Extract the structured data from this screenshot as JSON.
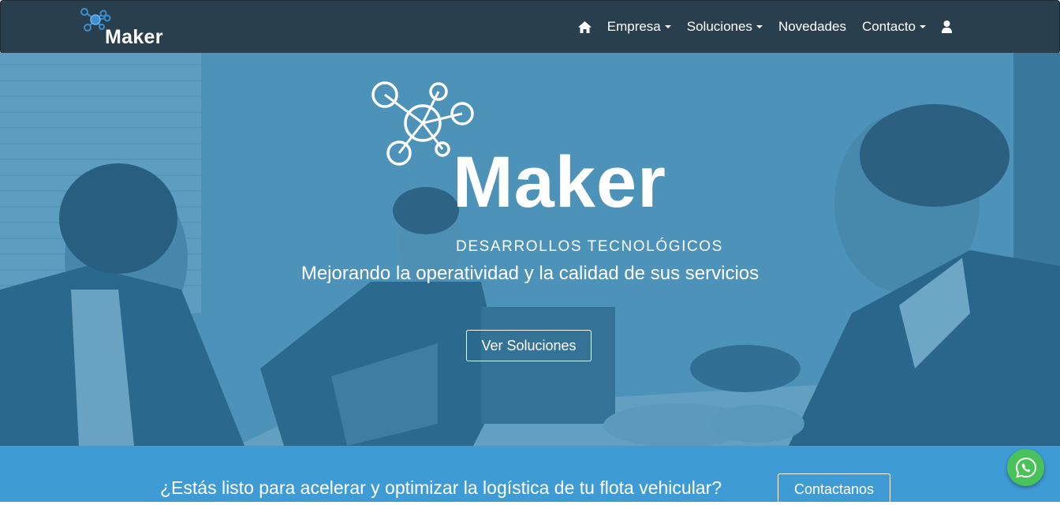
{
  "navbar": {
    "brand": "Maker",
    "items": [
      {
        "label": "Empresa",
        "dropdown": true
      },
      {
        "label": "Soluciones",
        "dropdown": true
      },
      {
        "label": "Novedades",
        "dropdown": false
      },
      {
        "label": "Contacto",
        "dropdown": true
      }
    ],
    "home_icon": "home-icon",
    "user_icon": "user-icon"
  },
  "hero": {
    "logo_word": "Maker",
    "logo_sub": "DESARROLLOS TECNOLÓGICOS",
    "tagline": "Mejorando la operatividad y la calidad de sus servicios",
    "button_label": "Ver Soluciones"
  },
  "cta": {
    "text": "¿Estás listo para acelerar y optimizar la logística de tu flota vehicular?",
    "button_label": "Contactanos"
  },
  "floating": {
    "icon": "whatsapp-icon"
  },
  "colors": {
    "navbar_bg": "#2a3f4d",
    "hero_tint": "#3482af",
    "cta_bg": "#3e9bd3",
    "whatsapp": "#49c25a",
    "brand_icon": "#3a8fd0"
  }
}
